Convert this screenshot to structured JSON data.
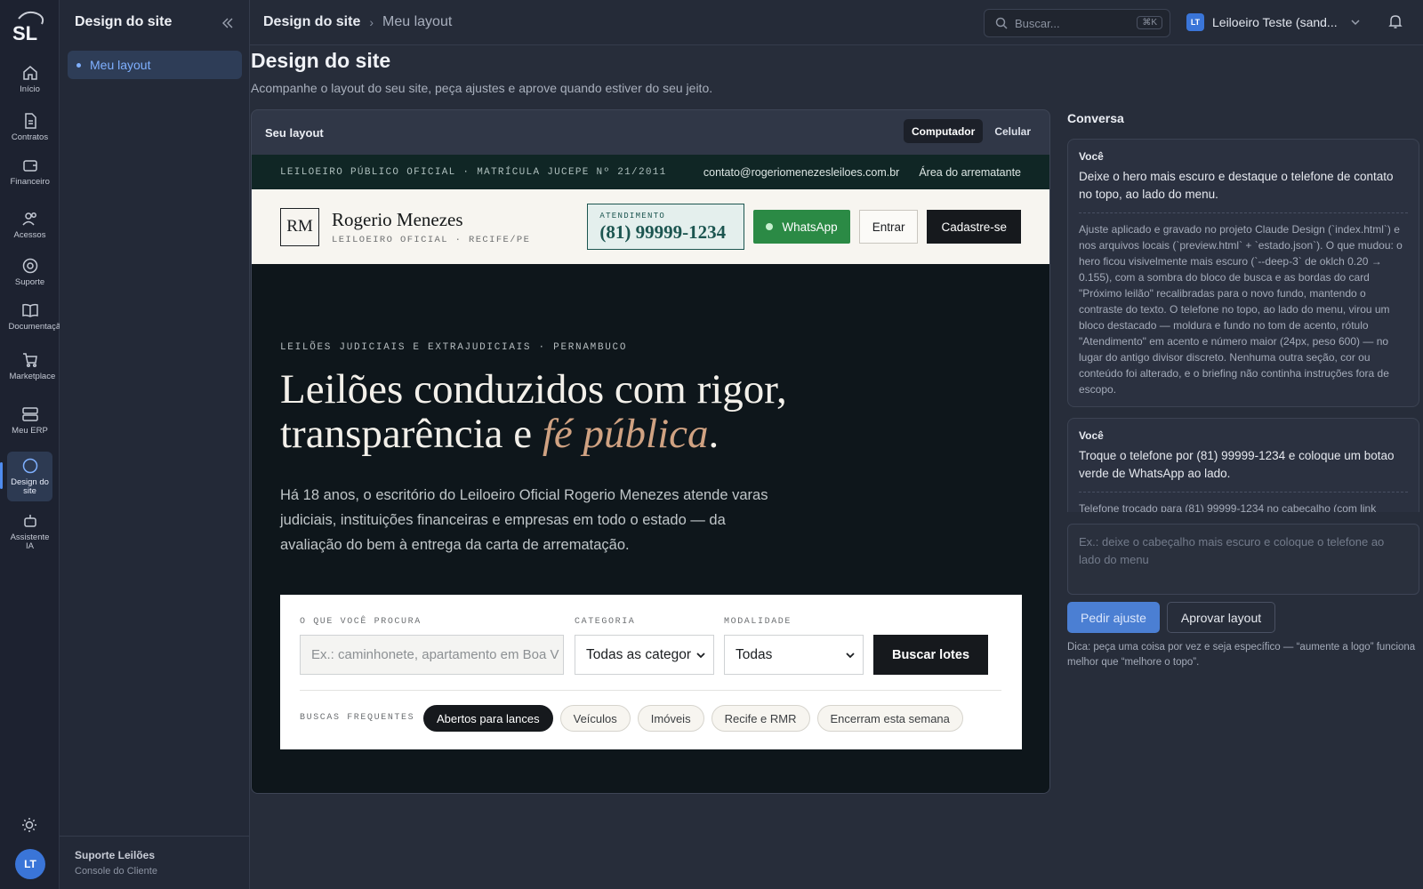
{
  "rail": {
    "logo": "SL",
    "items": [
      {
        "label": "Início",
        "icon": "home-icon"
      },
      {
        "label": "Contratos",
        "icon": "document-icon"
      },
      {
        "label": "Financeiro",
        "icon": "wallet-icon"
      },
      {
        "label": "Acessos",
        "icon": "users-icon"
      },
      {
        "label": "Suporte",
        "icon": "lifebuoy-icon"
      },
      {
        "label": "Documentação",
        "icon": "book-icon"
      },
      {
        "label": "Marketplace",
        "icon": "cart-icon"
      },
      {
        "label": "Meu ERP",
        "icon": "server-icon"
      },
      {
        "label": "Design do site",
        "icon": "circle-icon"
      },
      {
        "label": "Assistente IA",
        "icon": "robot-icon"
      }
    ],
    "avatar": "LT"
  },
  "sidebar": {
    "title": "Design do site",
    "nav_item": "Meu layout",
    "footer_title": "Suporte Leilões",
    "footer_sub": "Console do Cliente"
  },
  "topbar": {
    "breadcrumb_1": "Design do site",
    "breadcrumb_sep": "›",
    "breadcrumb_2": "Meu layout",
    "search_placeholder": "Buscar...",
    "search_kbd": "⌘K",
    "user_initials": "LT",
    "user_name": "Leiloeiro Teste (sand..."
  },
  "page": {
    "title": "Design do site",
    "subtitle": "Acompanhe o layout do seu site, peça ajustes e aprove quando estiver do seu jeito."
  },
  "preview": {
    "label": "Seu layout",
    "view_desktop": "Computador",
    "view_mobile": "Celular",
    "active_view": "Computador"
  },
  "site": {
    "strip_left": "LEILOEIRO PÚBLICO OFICIAL · MATRÍCULA JUCEPE Nº 21/2011",
    "strip_email": "contato@rogeriomenezesleiloes.com.br",
    "strip_area": "Área do arrematante",
    "monogram": "RM",
    "brand_name": "Rogerio Menezes",
    "brand_sub": "LEILOEIRO OFICIAL · RECIFE/PE",
    "attend_label": "ATENDIMENTO",
    "attend_phone": "(81) 99999-1234",
    "whatsapp": "WhatsApp",
    "login": "Entrar",
    "signup": "Cadastre-se",
    "eyebrow": "LEILÕES JUDICIAIS E EXTRAJUDICIAIS · PERNAMBUCO",
    "title_line1": "Leilões conduzidos com rigor,",
    "title_line2a": "transparência e ",
    "title_line2b": "fé pública",
    "title_line2c": ".",
    "lead": "Há 18 anos, o escritório do Leiloeiro Oficial Rogerio Menezes atende varas judiciais, instituições financeiras e empresas em todo o estado — da avaliação do bem à entrega da carta de arrematação.",
    "search": {
      "q_label": "O QUE VOCÊ PROCURA",
      "q_placeholder": "Ex.: caminhonete, apartamento em Boa V",
      "cat_label": "CATEGORIA",
      "cat_value": "Todas as categor",
      "mod_label": "MODALIDADE",
      "mod_value": "Todas",
      "button": "Buscar lotes",
      "freq_label": "BUSCAS FREQUENTES",
      "chips": [
        "Abertos para lances",
        "Veículos",
        "Imóveis",
        "Recife e RMR",
        "Encerram esta semana"
      ]
    }
  },
  "conversation": {
    "title": "Conversa",
    "messages": [
      {
        "author": "Você",
        "text": "Deixe o hero mais escuro e destaque o telefone de contato no topo, ao lado do menu.",
        "reply": "Ajuste aplicado e gravado no projeto Claude Design (`index.html`) e nos arquivos locais (`preview.html` + `estado.json`). O que mudou: o hero ficou visivelmente mais escuro (`--deep-3` de oklch 0.20 → 0.155), com a sombra do bloco de busca e as bordas do card \"Próximo leilão\" recalibradas para o novo fundo, mantendo o contraste do texto. O telefone no topo, ao lado do menu, virou um bloco destacado — moldura e fundo no tom de acento, rótulo \"Atendimento\" em acento e número maior (24px, peso 600) — no lugar do antigo divisor discreto. Nenhuma outra seção, cor ou conteúdo foi alterado, e o briefing não continha instruções fora de escopo."
      },
      {
        "author": "Você",
        "text": "Troque o telefone por (81) 99999-1234 e coloque um botao verde de WhatsApp ao lado.",
        "reply": "Telefone trocado para (81) 99999-1234 no cabeçalho (com link"
      }
    ],
    "input_placeholder": "Ex.: deixe o cabeçalho mais escuro e coloque o telefone ao lado do menu",
    "request_button": "Pedir ajuste",
    "approve_button": "Aprovar layout",
    "tip": "Dica: peça uma coisa por vez e seja específico — “aumente a logo” funciona melhor que “melhore o topo”."
  }
}
